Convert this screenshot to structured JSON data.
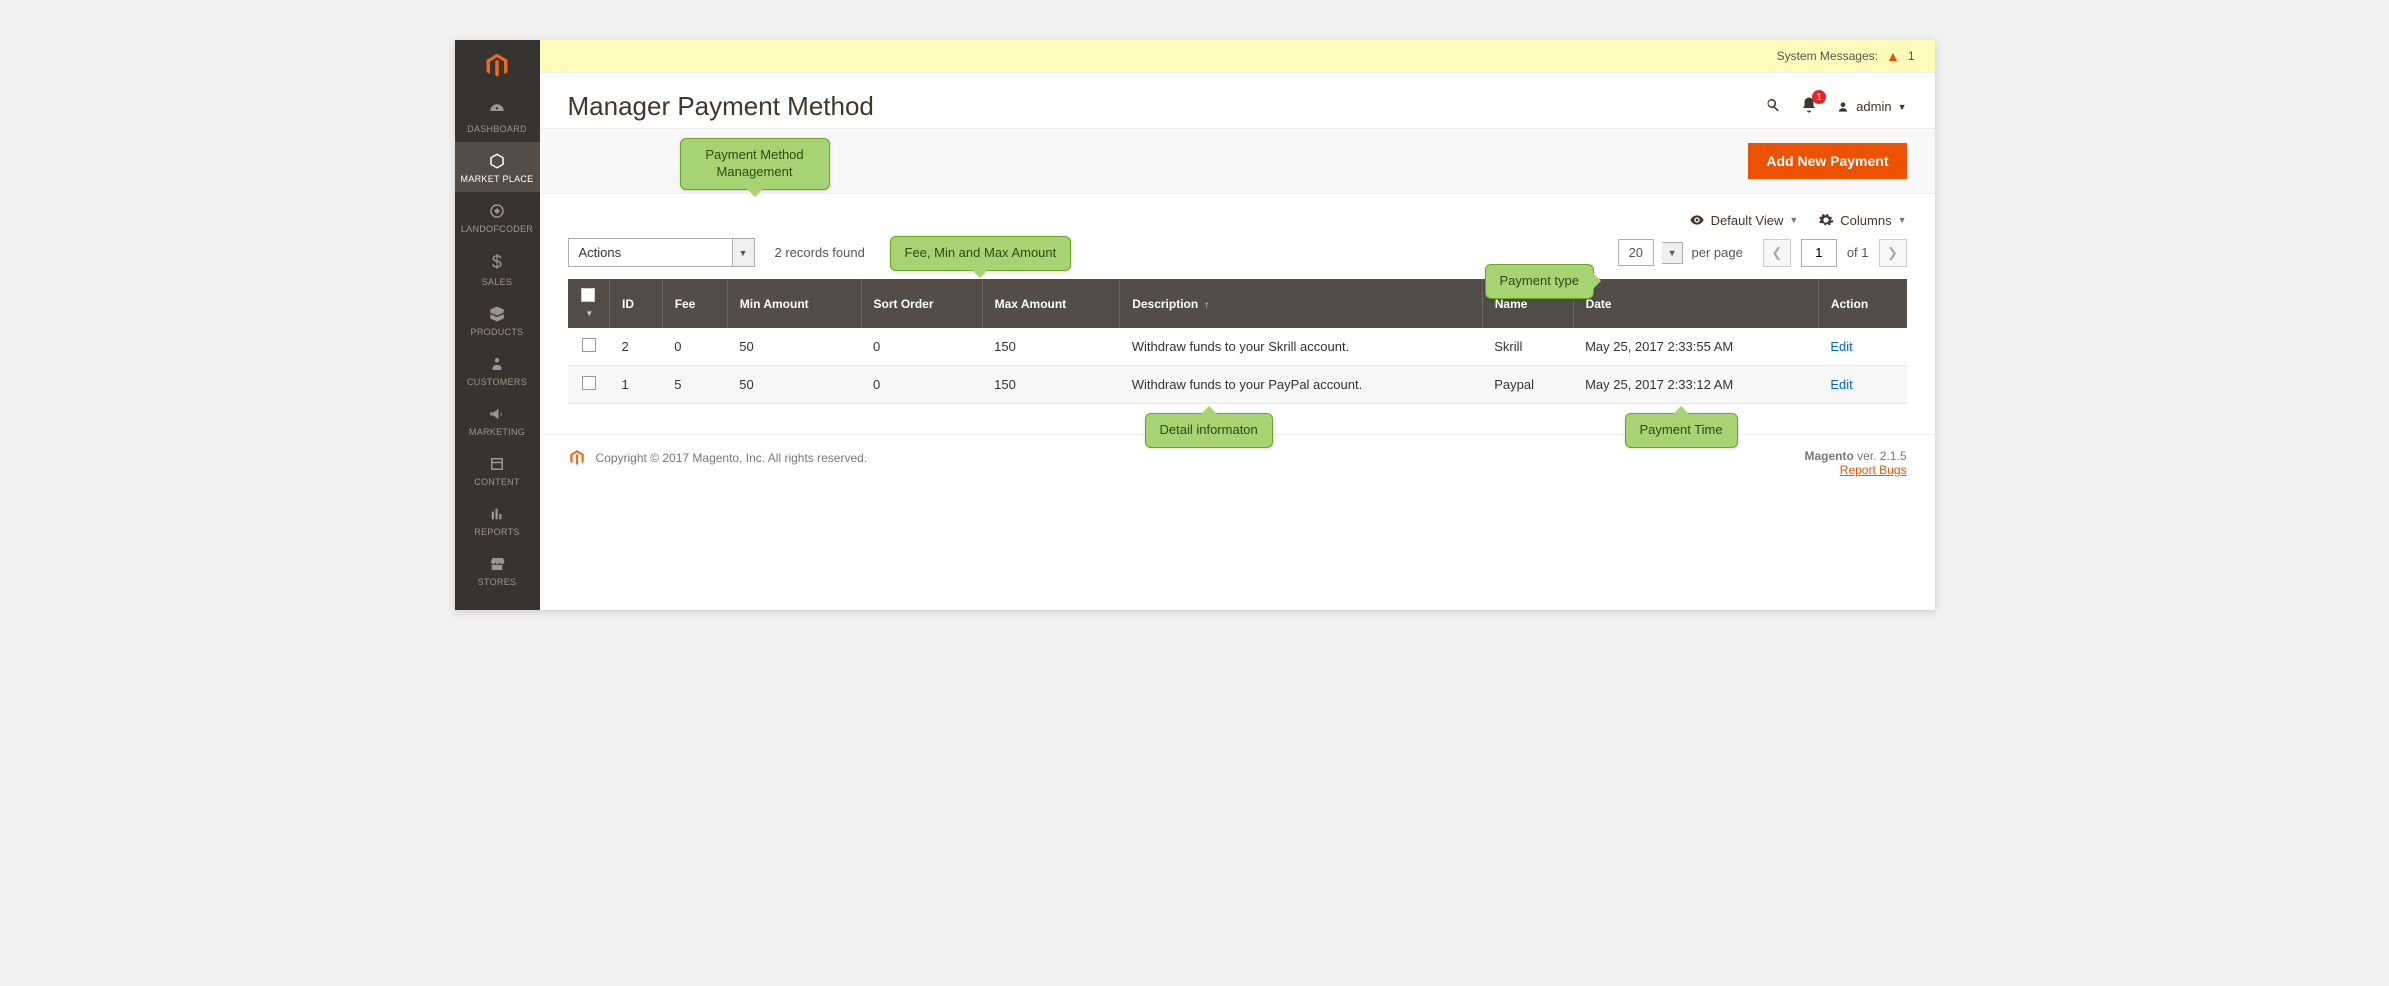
{
  "sysmsg": {
    "label": "System Messages:",
    "count": "1"
  },
  "header": {
    "title": "Manager Payment Method",
    "notif_badge": "1",
    "admin_label": "admin"
  },
  "action_bar": {
    "add_btn": "Add New Payment"
  },
  "toolbar": {
    "default_view": "Default View",
    "columns": "Columns"
  },
  "controls": {
    "actions_label": "Actions",
    "records_found": "2 records found",
    "perpage_value": "20",
    "perpage_label": "per page",
    "page_value": "1",
    "page_of": "of 1"
  },
  "grid": {
    "headers": {
      "id": "ID",
      "fee": "Fee",
      "min": "Min Amount",
      "sort": "Sort Order",
      "max": "Max Amount",
      "desc": "Description",
      "name": "Name",
      "date": "Date",
      "action": "Action"
    },
    "rows": [
      {
        "id": "2",
        "fee": "0",
        "min": "50",
        "sort": "0",
        "max": "150",
        "desc": "Withdraw funds to your Skrill account.",
        "name": "Skrill",
        "date": "May 25, 2017 2:33:55 AM",
        "action": "Edit"
      },
      {
        "id": "1",
        "fee": "5",
        "min": "50",
        "sort": "0",
        "max": "150",
        "desc": "Withdraw funds to your PayPal account.",
        "name": "Paypal",
        "date": "May 25, 2017 2:33:12 AM",
        "action": "Edit"
      }
    ]
  },
  "sidebar": {
    "items": [
      {
        "label": "DASHBOARD"
      },
      {
        "label": "MARKET PLACE"
      },
      {
        "label": "LANDOFCODER"
      },
      {
        "label": "SALES"
      },
      {
        "label": "PRODUCTS"
      },
      {
        "label": "CUSTOMERS"
      },
      {
        "label": "MARKETING"
      },
      {
        "label": "CONTENT"
      },
      {
        "label": "REPORTS"
      },
      {
        "label": "STORES"
      }
    ]
  },
  "footer": {
    "copyright": "Copyright © 2017 Magento, Inc. All rights reserved.",
    "version_prefix": "Magento",
    "version": " ver. 2.1.5",
    "report": "Report Bugs"
  },
  "callouts": {
    "mgmt_l1": "Payment Method",
    "mgmt_l2": "Management",
    "fee": "Fee, Min and Max Amount",
    "ptype": "Payment type",
    "detail": "Detail informaton",
    "ptime": "Payment Time"
  }
}
